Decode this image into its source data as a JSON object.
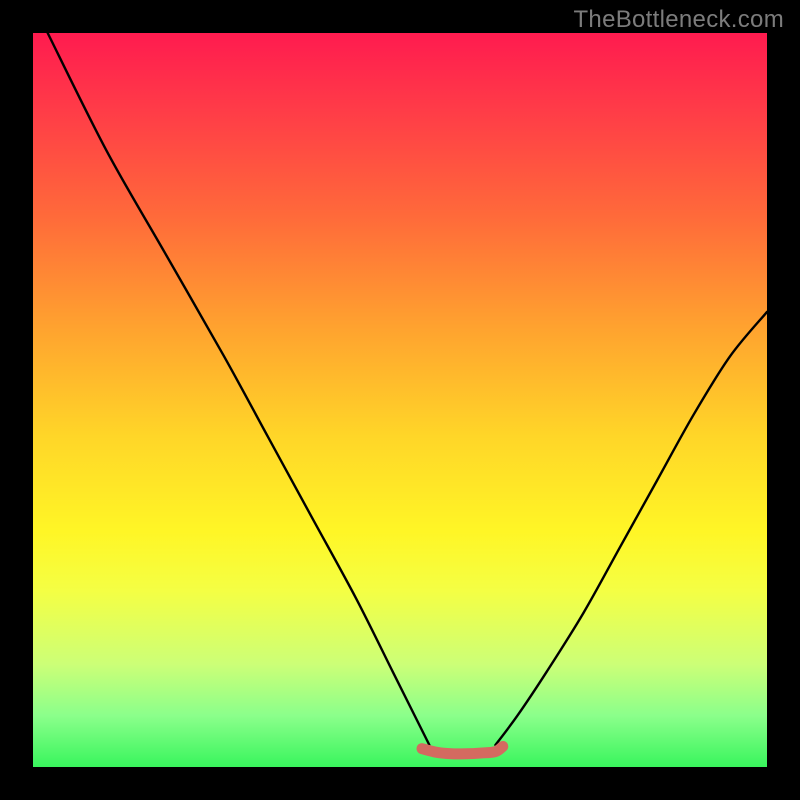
{
  "watermark": "TheBottleneck.com",
  "chart_data": {
    "type": "line",
    "title": "",
    "xlabel": "",
    "ylabel": "",
    "xlim": [
      0,
      100
    ],
    "ylim": [
      0,
      100
    ],
    "series": [
      {
        "name": "left-curve",
        "x": [
          2,
          10,
          18,
          26,
          32,
          38,
          44,
          49,
          52,
          54
        ],
        "values": [
          100,
          84,
          70,
          56,
          45,
          34,
          23,
          13,
          7,
          3
        ]
      },
      {
        "name": "right-curve",
        "x": [
          63,
          66,
          70,
          75,
          80,
          85,
          90,
          95,
          100
        ],
        "values": [
          3,
          7,
          13,
          21,
          30,
          39,
          48,
          56,
          62
        ]
      },
      {
        "name": "flat-bottom-band",
        "x": [
          53,
          55,
          57,
          59,
          61,
          63,
          64
        ],
        "values": [
          2.5,
          2.0,
          1.8,
          1.8,
          1.9,
          2.1,
          2.8
        ]
      }
    ],
    "colors": {
      "curve": "#000000",
      "band": "#d46a60"
    }
  }
}
